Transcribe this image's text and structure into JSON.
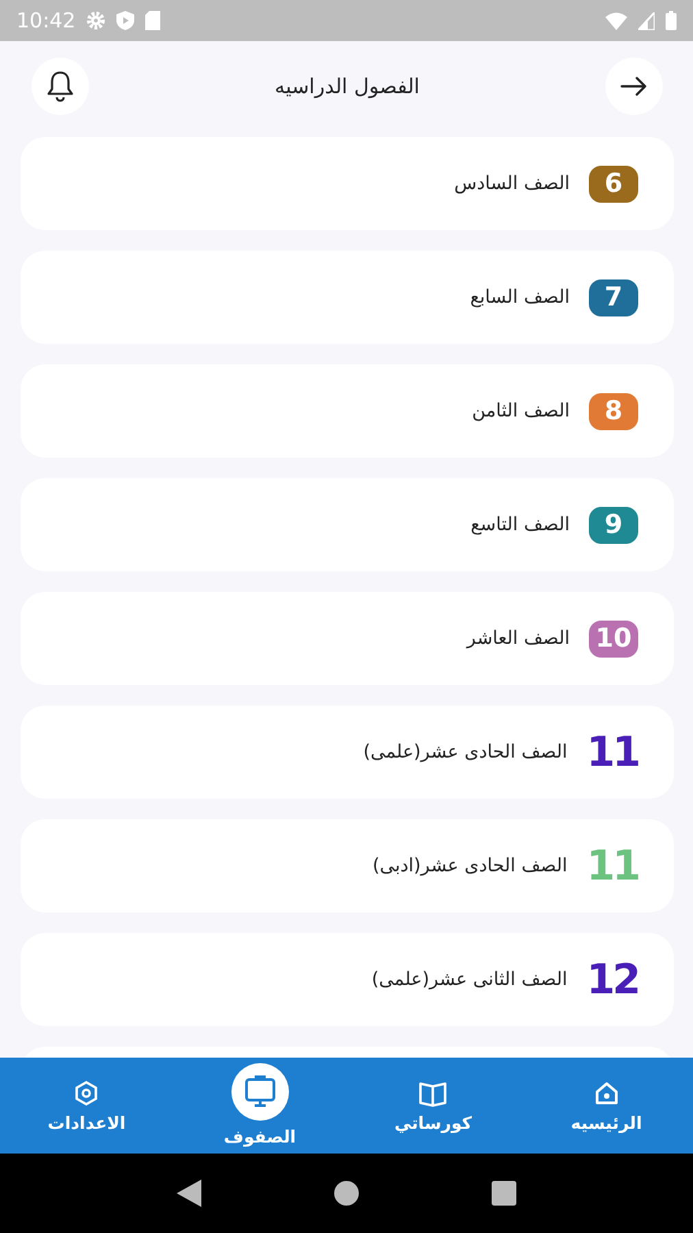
{
  "status_bar": {
    "time": "10:42"
  },
  "header": {
    "title": "الفصول الدراسيه"
  },
  "grades": [
    {
      "number": "6",
      "label": "الصف السادس",
      "kind": "badge",
      "color": "#9a6b1c"
    },
    {
      "number": "7",
      "label": "الصف السابع",
      "kind": "badge",
      "color": "#1f6f9a"
    },
    {
      "number": "8",
      "label": "الصف الثامن",
      "kind": "badge",
      "color": "#e07a35"
    },
    {
      "number": "9",
      "label": "الصف التاسع",
      "kind": "badge",
      "color": "#1f8a94"
    },
    {
      "number": "10",
      "label": "الصف العاشر",
      "kind": "badge",
      "color": "#b971b2"
    },
    {
      "number": "11",
      "label": "الصف الحادى عشر(علمى)",
      "kind": "numeral",
      "color": "#4a1fb8"
    },
    {
      "number": "11",
      "label": "الصف الحادى عشر(ادبى)",
      "kind": "numeral",
      "color": "#6cc27f"
    },
    {
      "number": "12",
      "label": "الصف الثانى عشر(علمى)",
      "kind": "numeral",
      "color": "#4a1fb8"
    }
  ],
  "bottom_nav": [
    {
      "label": "الرئيسيه",
      "selected": false
    },
    {
      "label": "كورساتي",
      "selected": false
    },
    {
      "label": "الصفوف",
      "selected": true
    },
    {
      "label": "الاعدادات",
      "selected": false
    }
  ]
}
